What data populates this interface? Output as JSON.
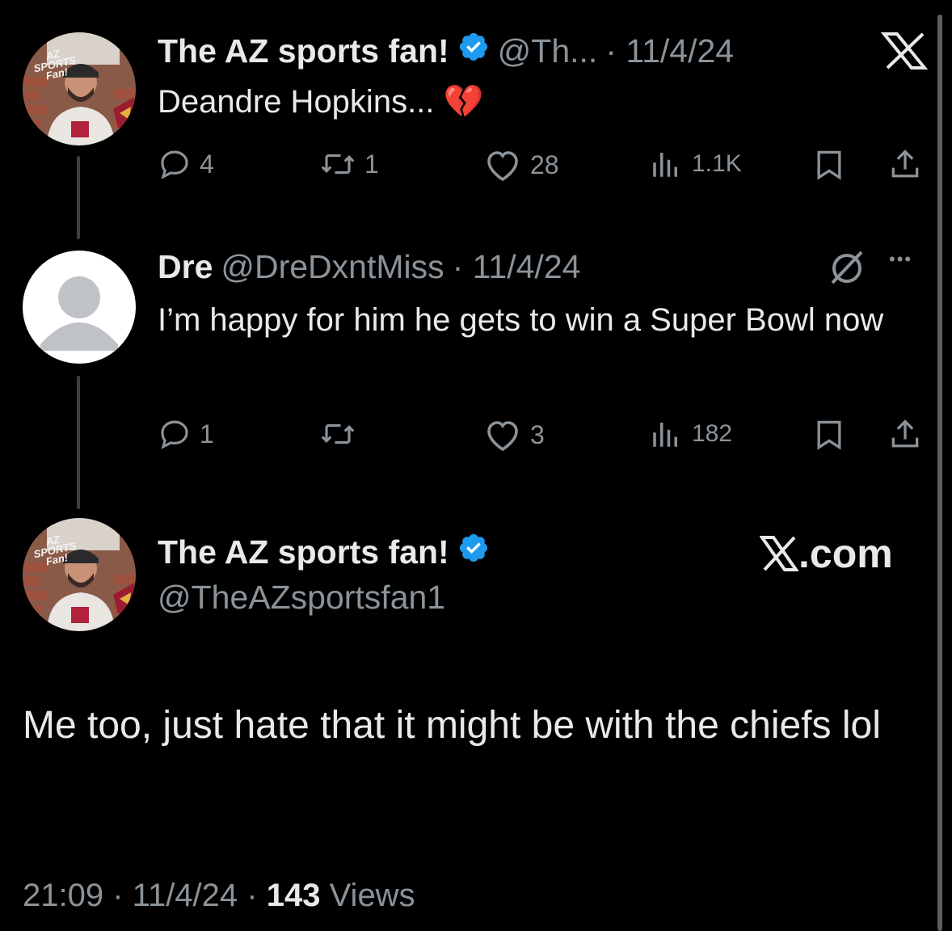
{
  "tweet1": {
    "name": "The AZ sports fan!",
    "handle": "@Th...",
    "date": "· 11/4/24",
    "text": "Deandre Hopkins... ",
    "emoji": "💔",
    "replies": "4",
    "retweets": "1",
    "likes": "28",
    "views": "1.1K",
    "avatar_text": "AZ SPORTS Fan!"
  },
  "tweet2": {
    "name": "Dre",
    "handle": "@DreDxntMiss",
    "date": "· 11/4/24",
    "text": "I’m happy for him he gets to win a Super Bowl now",
    "replies": "1",
    "retweets": "",
    "likes": "3",
    "views": "182",
    "more_icon": "•••"
  },
  "tweet3": {
    "name": "The AZ sports fan!",
    "handle": "@TheAZsportsfan1",
    "text": "Me too, just hate that it might be with the chiefs lol",
    "time": "21:09",
    "date": "· 11/4/24 ·",
    "views_count": "143",
    "views_label": "Views",
    "avatar_text": "AZ SPORTS Fan!"
  },
  "watermark": {
    "site": ".com"
  },
  "colors": {
    "verified": "#1d9bf0",
    "background": "#000000",
    "muted": "#8b9399",
    "text": "#e7e9ea"
  }
}
